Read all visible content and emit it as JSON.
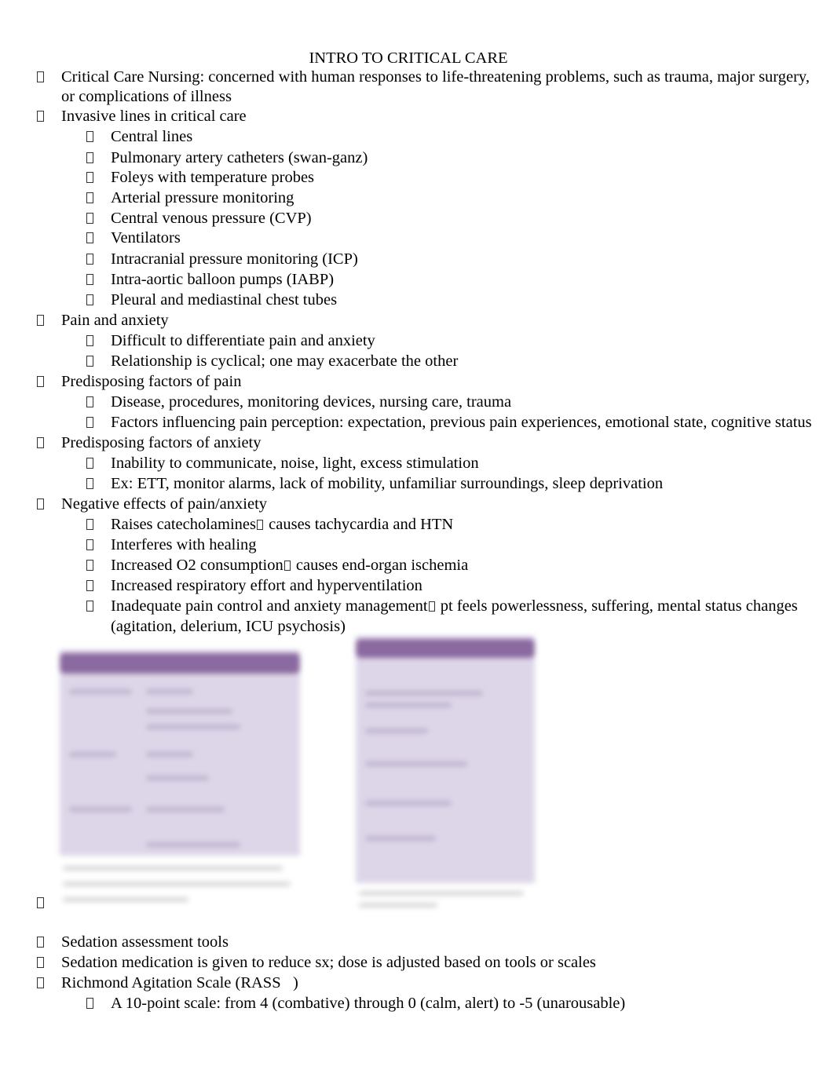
{
  "document": {
    "title": "INTRO TO CRITICAL CARE",
    "bullet_icon": "missing-glyph-box",
    "inline_arrow_icon": "missing-glyph-box",
    "items": [
      {
        "level": 1,
        "text": "Critical Care Nursing: concerned with human responses to life-threatening problems, such as trauma, major surgery,"
      },
      {
        "level": 1,
        "continuation": true,
        "text": "or complications of illness"
      },
      {
        "level": 1,
        "text": "Invasive lines in critical care"
      },
      {
        "level": 2,
        "text": "Central lines"
      },
      {
        "level": 2,
        "text": "Pulmonary artery catheters (swan-ganz)"
      },
      {
        "level": 2,
        "text": "Foleys with temperature probes"
      },
      {
        "level": 2,
        "text": "Arterial pressure monitoring"
      },
      {
        "level": 2,
        "text": "Central venous pressure (CVP)"
      },
      {
        "level": 2,
        "text": "Ventilators"
      },
      {
        "level": 2,
        "text": "Intracranial pressure monitoring (ICP)"
      },
      {
        "level": 2,
        "text": "Intra-aortic balloon pumps (IABP)"
      },
      {
        "level": 2,
        "text": "Pleural and mediastinal chest tubes"
      },
      {
        "level": 1,
        "text": "Pain and anxiety"
      },
      {
        "level": 2,
        "text": "Difficult to differentiate pain and anxiety"
      },
      {
        "level": 2,
        "text": "Relationship is cyclical; one may exacerbate the other"
      },
      {
        "level": 1,
        "text": "Predisposing factors of pain"
      },
      {
        "level": 2,
        "text": "Disease, procedures, monitoring devices, nursing care, trauma"
      },
      {
        "level": 2,
        "text": "Factors influencing pain perception: expectation, previous pain experiences, emotional state, cognitive status"
      },
      {
        "level": 1,
        "text": "Predisposing factors of anxiety"
      },
      {
        "level": 2,
        "text": "Inability to communicate, noise, light, excess stimulation"
      },
      {
        "level": 2,
        "text": "Ex: ETT, monitor alarms, lack of mobility, unfamiliar surroundings, sleep deprivation"
      },
      {
        "level": 1,
        "text": "Negative effects of pain/anxiety"
      },
      {
        "level": 2,
        "text_before": "Raises catecholamines",
        "text_after": " causes tachycardia and HTN"
      },
      {
        "level": 2,
        "text": "Interferes with healing"
      },
      {
        "level": 2,
        "text_before": "Increased O2 consumption",
        "text_after": " causes end-organ ischemia"
      },
      {
        "level": 2,
        "text": "Increased respiratory effort and hyperventilation"
      },
      {
        "level": 2,
        "text_before": "Inadequate pain control and anxiety management",
        "text_after": " pt feels powerlessness, suffering, mental status changes"
      },
      {
        "level": 2,
        "continuation": true,
        "text": "(agitation, delerium, ICU psychosis)"
      },
      {
        "level": 1,
        "text": "Sedation assessment tools"
      },
      {
        "level": 1,
        "text": "Sedation medication is given to reduce sx; dose is adjusted based on tools or scales"
      },
      {
        "level": 1,
        "text": "Richmond Agitation Scale (RASS   )"
      },
      {
        "level": 2,
        "text": "A 10-point scale: from 4 (combative) through 0 (calm, alert) to -5 (unarousable)"
      }
    ],
    "figures": [
      {
        "name": "blurred-table-figure-1",
        "description": "blurred purple-header table image"
      },
      {
        "name": "blurred-table-figure-2",
        "description": "blurred purple-header table image"
      }
    ],
    "colors": {
      "figure_header": "#8a6aa0",
      "figure_body": "#ddd6e8"
    }
  }
}
